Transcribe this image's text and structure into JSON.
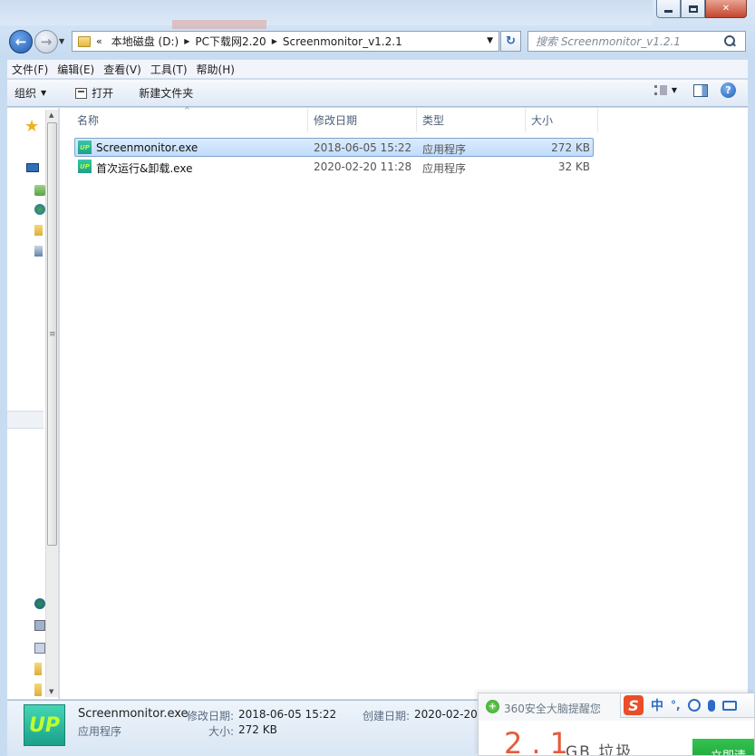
{
  "address": {
    "overflow": "«",
    "segments": [
      "本地磁盘 (D:)",
      "PC下载网2.20",
      "Screenmonitor_v1.2.1"
    ]
  },
  "search": {
    "placeholder": "搜索 Screenmonitor_v1.2.1"
  },
  "menu": [
    "文件(F)",
    "编辑(E)",
    "查看(V)",
    "工具(T)",
    "帮助(H)"
  ],
  "toolbar": {
    "organize": "组织",
    "open": "打开",
    "new_folder": "新建文件夹"
  },
  "columns": {
    "name": "名称",
    "date": "修改日期",
    "type": "类型",
    "size": "大小"
  },
  "files": [
    {
      "name": "Screenmonitor.exe",
      "date": "2018-06-05 15:22",
      "type": "应用程序",
      "size": "272 KB",
      "selected": true
    },
    {
      "name": "首次运行&卸载.exe",
      "date": "2020-02-20 11:28",
      "type": "应用程序",
      "size": "32 KB",
      "selected": false
    }
  ],
  "details": {
    "name": "Screenmonitor.exe",
    "kind": "应用程序",
    "modified_label": "修改日期:",
    "modified": "2018-06-05 15:22",
    "size_label": "大小:",
    "size": "272 KB",
    "created_label": "创建日期:",
    "created": "2020-02-20"
  },
  "popup": {
    "title": "360安全大脑提醒您",
    "number": "2.1",
    "unit": "GB 垃圾",
    "button": "立即清"
  },
  "ime": {
    "lang": "中",
    "punct": "°,"
  },
  "icon_labels": {
    "exe": "UP"
  },
  "colors": {
    "selection": "#c1dcfc",
    "accent": "#1f5cb2",
    "popup_number": "#e45b3a"
  }
}
